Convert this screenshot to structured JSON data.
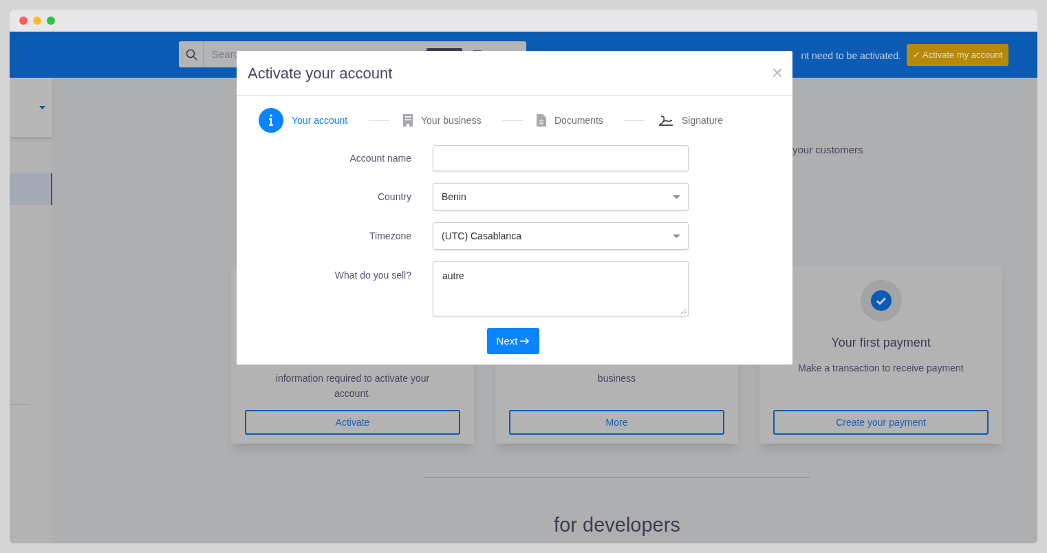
{
  "header": {
    "search": {
      "placeholder": "Searc"
    },
    "notice": "nt need to be activated.",
    "activate_button": {
      "icon": "✓",
      "label": "Activate my account"
    }
  },
  "background": {
    "partial_text": "your customers",
    "cards": [
      {
        "kind": "plain",
        "lines": [
          "information required to activate your",
          "account."
        ],
        "button": "Activate"
      },
      {
        "kind": "plain",
        "lines": [
          "business"
        ],
        "button": "More"
      },
      {
        "kind": "icon",
        "title": "Your first payment",
        "lines": [
          "Make a transaction to receive payment"
        ],
        "button": "Create your payment"
      }
    ],
    "section_title": "for developers"
  },
  "modal": {
    "title": "Activate your account",
    "close": "×",
    "steps": [
      {
        "label": "Your account",
        "selected": true
      },
      {
        "label": "Your business",
        "selected": false
      },
      {
        "label": "Documents",
        "selected": false
      },
      {
        "label": "Signature",
        "selected": false
      }
    ],
    "fields": [
      {
        "kind": "text",
        "label": "Account name"
      },
      {
        "kind": "select",
        "label": "Country",
        "value": "Benin"
      },
      {
        "kind": "select",
        "label": "Timezone",
        "value": "(UTC) Casablanca"
      },
      {
        "kind": "textarea",
        "label": "What do you sell?",
        "value": "autre"
      }
    ],
    "next_button": "Next"
  }
}
